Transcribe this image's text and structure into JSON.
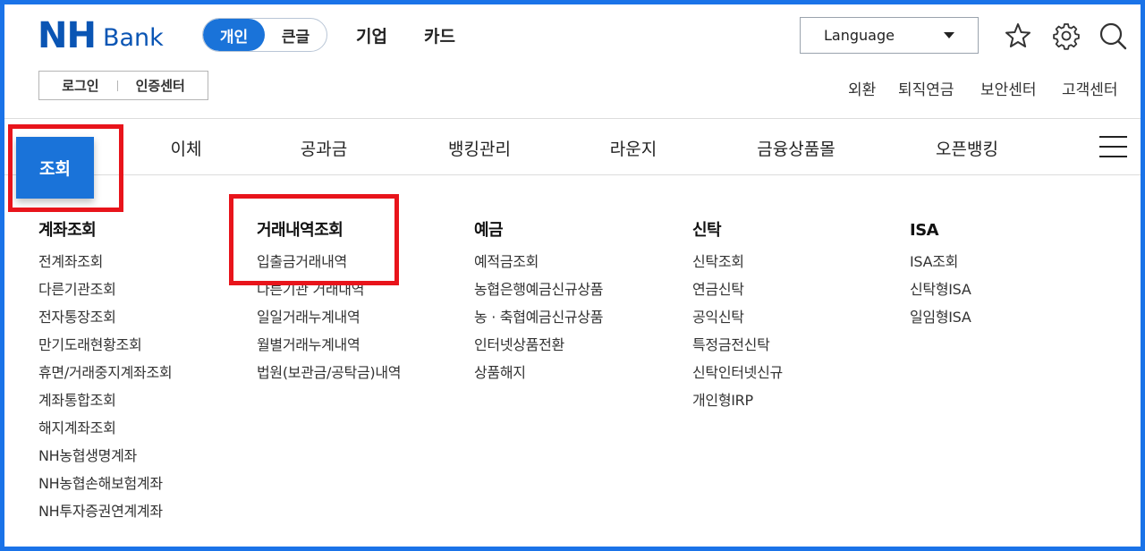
{
  "header": {
    "logo_nh": "NH",
    "logo_bank": "Bank",
    "segments": [
      {
        "label": "개인",
        "active": true
      },
      {
        "label": "큰글",
        "active": false
      }
    ],
    "top_links": [
      "기업",
      "카드"
    ],
    "language_label": "Language",
    "icons": [
      "star-icon",
      "gear-icon",
      "search-icon"
    ],
    "auth_buttons": [
      "로그인",
      "인증센터"
    ],
    "util_links": [
      "외환",
      "퇴직연금",
      "보안센터",
      "고객센터"
    ]
  },
  "gnb": {
    "active": "조회",
    "items": [
      "이체",
      "공과금",
      "뱅킹관리",
      "라운지",
      "금융상품몰",
      "오픈뱅킹"
    ]
  },
  "menu_columns": [
    {
      "title": "계좌조회",
      "items": [
        "전계좌조회",
        "다른기관조회",
        "전자통장조회",
        "만기도래현황조회",
        "휴면/거래중지계좌조회",
        "계좌통합조회",
        "해지계좌조회",
        "NH농협생명계좌",
        "NH농협손해보험계좌",
        "NH투자증권연계계좌"
      ]
    },
    {
      "title": "거래내역조회",
      "items": [
        "입출금거래내역",
        "다른기관 거래내역",
        "일일거래누계내역",
        "월별거래누계내역",
        "법원(보관금/공탁금)내역"
      ]
    },
    {
      "title": "예금",
      "items": [
        "예적금조회",
        "농협은행예금신규상품",
        "농 · 축협예금신규상품",
        "인터넷상품전환",
        "상품해지"
      ]
    },
    {
      "title": "신탁",
      "items": [
        "신탁조회",
        "연금신탁",
        "공익신탁",
        "특정금전신탁",
        "신탁인터넷신규",
        "개인형IRP"
      ]
    },
    {
      "title": "ISA",
      "items": [
        "ISA조회",
        "신탁형ISA",
        "일임형ISA"
      ]
    }
  ],
  "colors": {
    "brand_blue": "#0a55b4",
    "accent_blue": "#1a73d9",
    "highlight_red": "#e8141b",
    "frame_blue": "#1a73e8"
  }
}
